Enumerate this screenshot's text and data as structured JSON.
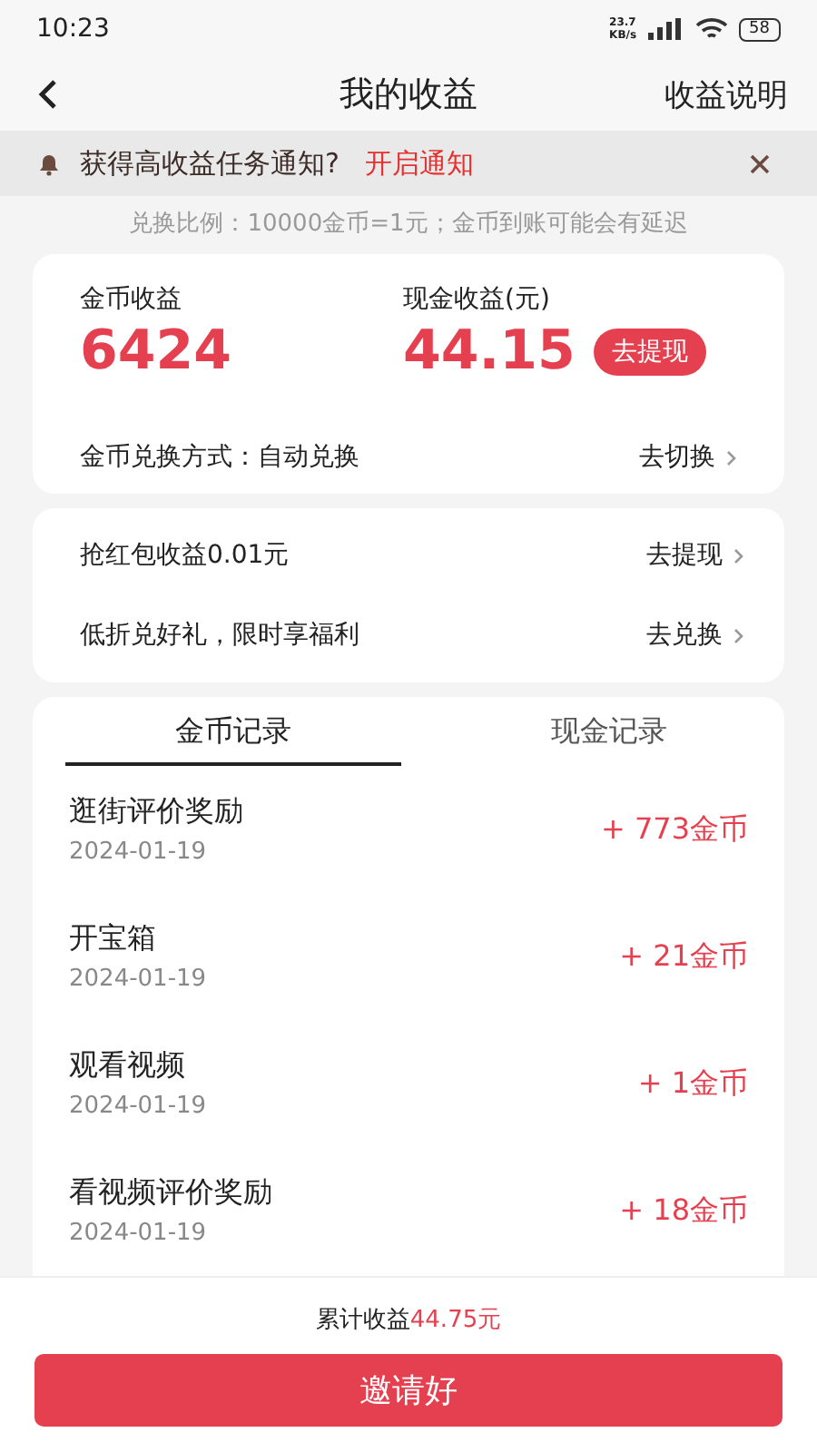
{
  "status_bar": {
    "time": "10:23",
    "speed": "23.7",
    "speed_unit": "KB/s",
    "battery": "58"
  },
  "header": {
    "title": "我的收益",
    "action": "收益说明"
  },
  "notice": {
    "text": "获得高收益任务通知?",
    "link": "开启通知"
  },
  "ratio_note": "兑换比例：10000金币=1元；金币到账可能会有延迟",
  "summary": {
    "coins_label": "金币收益",
    "coins_value": "6424",
    "cash_label": "现金收益(元)",
    "cash_value": "44.15",
    "withdraw_button": "去提现",
    "exchange_mode": "金币兑换方式：自动兑换",
    "exchange_action": "去切换"
  },
  "offers": [
    {
      "text": "抢红包收益0.01元",
      "action": "去提现"
    },
    {
      "text": "低折兑好礼，限时享福利",
      "action": "去兑换"
    }
  ],
  "tabs": [
    {
      "label": "金币记录",
      "selected": true
    },
    {
      "label": "现金记录",
      "selected": false
    }
  ],
  "records": [
    {
      "title": "逛街评价奖励",
      "date": "2024-01-19",
      "amount": "+ 773金币"
    },
    {
      "title": "开宝箱",
      "date": "2024-01-19",
      "amount": "+ 21金币"
    },
    {
      "title": "观看视频",
      "date": "2024-01-19",
      "amount": "+ 1金币"
    },
    {
      "title": "看视频评价奖励",
      "date": "2024-01-19",
      "amount": "+ 18金币"
    }
  ],
  "footer": {
    "total_label": "累计收益",
    "total_value": "44.75元",
    "invite_button": "邀请好"
  }
}
